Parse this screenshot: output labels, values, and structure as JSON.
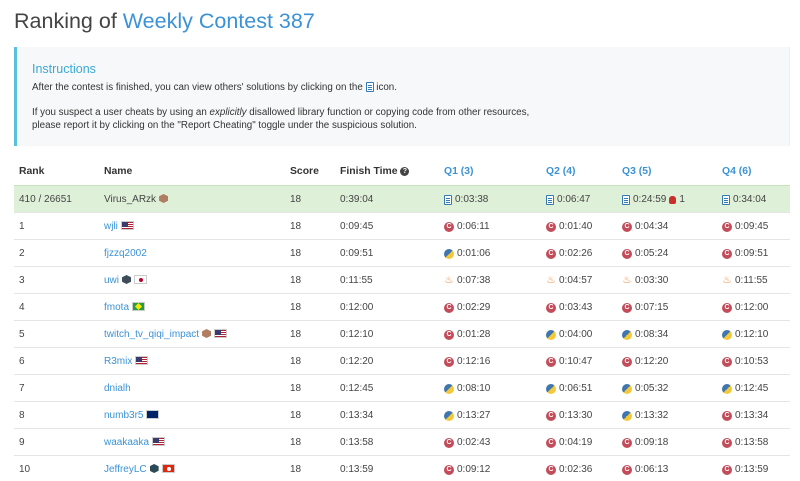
{
  "page": {
    "title_prefix": "Ranking of ",
    "title_link": "Weekly Contest 387"
  },
  "instructions": {
    "title": "Instructions",
    "p1_before": "After the contest is finished, you can view others' solutions by clicking on the",
    "p1_after": "icon.",
    "p2_a": "If you suspect a user cheats by using an ",
    "p2_em": "explicitly",
    "p2_b": " disallowed library function or copying code from other resources,",
    "p2_c": "please report it by clicking on the \"Report Cheating\" toggle under the suspicious solution."
  },
  "table": {
    "headers": {
      "rank": "Rank",
      "name": "Name",
      "score": "Score",
      "finish": "Finish Time",
      "finish_help": "?",
      "q1": "Q1 (3)",
      "q2": "Q2 (4)",
      "q3": "Q3 (5)",
      "q4": "Q4 (6)"
    },
    "rows": [
      {
        "rank": "410 / 26651",
        "name": "Virus_ARzk",
        "badge": "bronze",
        "flags": [],
        "score": "18",
        "finish": "0:39:04",
        "q": [
          {
            "lang": "doc",
            "time": "0:03:38"
          },
          {
            "lang": "doc",
            "time": "0:06:47"
          },
          {
            "lang": "doc",
            "time": "0:24:59",
            "bug": "1"
          },
          {
            "lang": "doc",
            "time": "0:34:04"
          }
        ]
      },
      {
        "rank": "1",
        "name": "wjli",
        "badge": "none",
        "flags": [
          "us"
        ],
        "score": "18",
        "finish": "0:09:45",
        "q": [
          {
            "lang": "cpp",
            "time": "0:06:11"
          },
          {
            "lang": "cpp",
            "time": "0:01:40"
          },
          {
            "lang": "cpp",
            "time": "0:04:34"
          },
          {
            "lang": "cpp",
            "time": "0:09:45"
          }
        ]
      },
      {
        "rank": "2",
        "name": "fjzzq2002",
        "badge": "none",
        "flags": [],
        "score": "18",
        "finish": "0:09:51",
        "q": [
          {
            "lang": "py",
            "time": "0:01:06"
          },
          {
            "lang": "cpp",
            "time": "0:02:26"
          },
          {
            "lang": "cpp",
            "time": "0:05:24"
          },
          {
            "lang": "cpp",
            "time": "0:09:51"
          }
        ]
      },
      {
        "rank": "3",
        "name": "uwi",
        "badge": "guardian",
        "flags": [
          "jp"
        ],
        "score": "18",
        "finish": "0:11:55",
        "q": [
          {
            "lang": "java",
            "time": "0:07:38"
          },
          {
            "lang": "java",
            "time": "0:04:57"
          },
          {
            "lang": "java",
            "time": "0:03:30"
          },
          {
            "lang": "java",
            "time": "0:11:55"
          }
        ]
      },
      {
        "rank": "4",
        "name": "fmota",
        "badge": "none",
        "flags": [
          "br"
        ],
        "score": "18",
        "finish": "0:12:00",
        "q": [
          {
            "lang": "cpp",
            "time": "0:02:29"
          },
          {
            "lang": "cpp",
            "time": "0:03:43"
          },
          {
            "lang": "cpp",
            "time": "0:07:15"
          },
          {
            "lang": "cpp",
            "time": "0:12:00"
          }
        ]
      },
      {
        "rank": "5",
        "name": "twitch_tv_qiqi_impact",
        "badge": "bronze",
        "flags": [
          "us"
        ],
        "score": "18",
        "finish": "0:12:10",
        "q": [
          {
            "lang": "cpp",
            "time": "0:01:28"
          },
          {
            "lang": "py",
            "time": "0:04:00"
          },
          {
            "lang": "py",
            "time": "0:08:34"
          },
          {
            "lang": "py",
            "time": "0:12:10"
          }
        ]
      },
      {
        "rank": "6",
        "name": "R3mix",
        "badge": "none",
        "flags": [
          "us"
        ],
        "score": "18",
        "finish": "0:12:20",
        "q": [
          {
            "lang": "cpp",
            "time": "0:12:16"
          },
          {
            "lang": "cpp",
            "time": "0:10:47"
          },
          {
            "lang": "cpp",
            "time": "0:12:20"
          },
          {
            "lang": "cpp",
            "time": "0:10:53"
          }
        ]
      },
      {
        "rank": "7",
        "name": "dnialh",
        "badge": "none",
        "flags": [],
        "score": "18",
        "finish": "0:12:45",
        "q": [
          {
            "lang": "py",
            "time": "0:08:10"
          },
          {
            "lang": "py",
            "time": "0:06:51"
          },
          {
            "lang": "py",
            "time": "0:05:32"
          },
          {
            "lang": "py",
            "time": "0:12:45"
          }
        ]
      },
      {
        "rank": "8",
        "name": "numb3r5",
        "badge": "none",
        "flags": [
          "au"
        ],
        "score": "18",
        "finish": "0:13:34",
        "q": [
          {
            "lang": "py",
            "time": "0:13:27"
          },
          {
            "lang": "cpp",
            "time": "0:13:30"
          },
          {
            "lang": "py",
            "time": "0:13:32"
          },
          {
            "lang": "cpp",
            "time": "0:13:34"
          }
        ]
      },
      {
        "rank": "9",
        "name": "waakaaka",
        "badge": "none",
        "flags": [
          "us"
        ],
        "score": "18",
        "finish": "0:13:58",
        "q": [
          {
            "lang": "cpp",
            "time": "0:02:43"
          },
          {
            "lang": "cpp",
            "time": "0:04:19"
          },
          {
            "lang": "cpp",
            "time": "0:09:18"
          },
          {
            "lang": "cpp",
            "time": "0:13:58"
          }
        ]
      },
      {
        "rank": "10",
        "name": "JeffreyLC",
        "badge": "knight",
        "flags": [
          "hk"
        ],
        "score": "18",
        "finish": "0:13:59",
        "q": [
          {
            "lang": "cpp",
            "time": "0:09:12"
          },
          {
            "lang": "cpp",
            "time": "0:02:36"
          },
          {
            "lang": "cpp",
            "time": "0:06:13"
          },
          {
            "lang": "cpp",
            "time": "0:13:59"
          }
        ]
      }
    ]
  }
}
